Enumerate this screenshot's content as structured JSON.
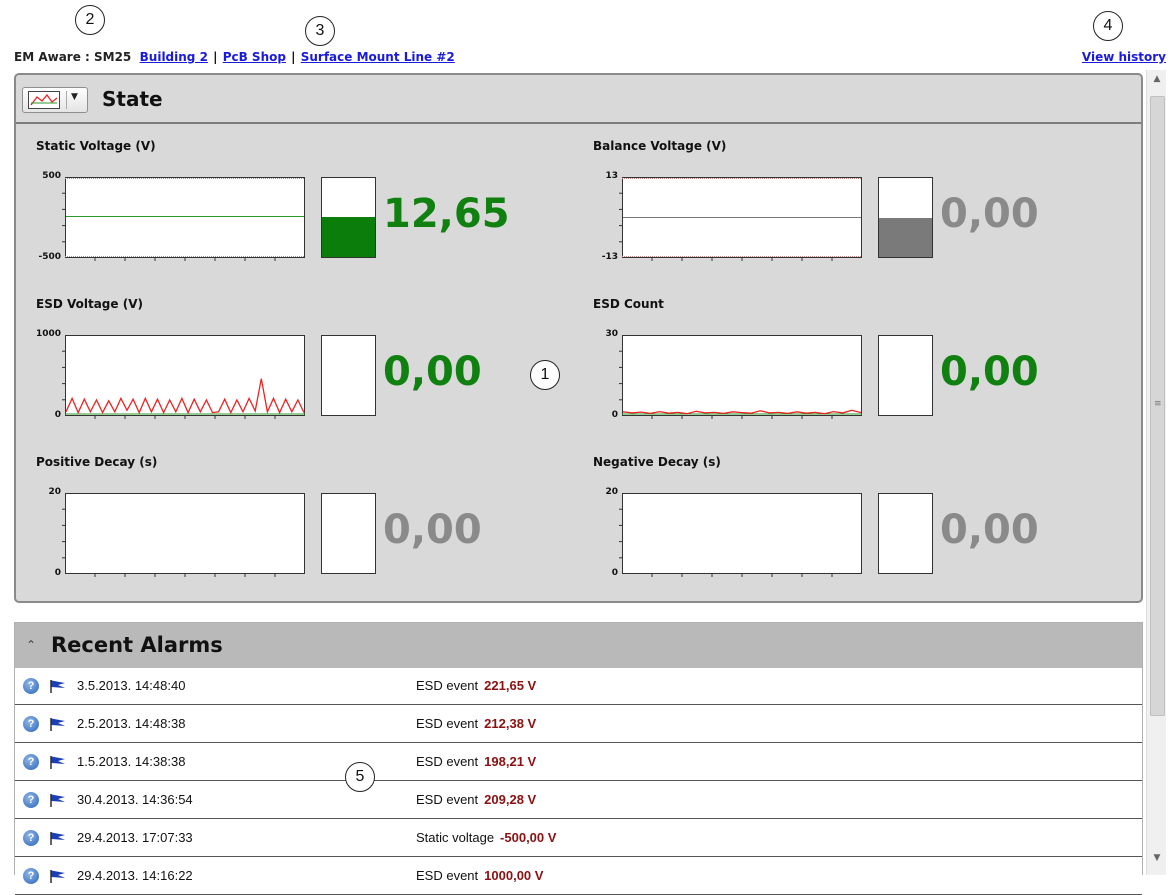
{
  "callouts": [
    "1",
    "2",
    "3",
    "4",
    "5"
  ],
  "breadcrumb": {
    "prefix": "EM Aware : SM25",
    "links": [
      "Building 2",
      "PcB Shop",
      "Surface Mount Line #2"
    ],
    "separator": "|"
  },
  "view_history": "View history",
  "state": {
    "title": "State",
    "metrics": [
      {
        "label": "Static Voltage (V)",
        "ymax": "500",
        "ymin": "-500",
        "value": "12,65",
        "value_color": "#108010",
        "gauge_level": 0.51,
        "gauge_color": "#0b7d0b"
      },
      {
        "label": "Balance Voltage (V)",
        "ymax": "13",
        "ymin": "-13",
        "value": "0,00",
        "value_color": "#8a8a8a",
        "gauge_level": 0.5,
        "gauge_color": "#7a7a7a"
      },
      {
        "label": "ESD Voltage (V)",
        "ymax": "1000",
        "ymin": "0",
        "value": "0,00",
        "value_color": "#108010",
        "gauge_level": 0,
        "gauge_color": "#0b7d0b"
      },
      {
        "label": "ESD Count",
        "ymax": "30",
        "ymin": "0",
        "value": "0,00",
        "value_color": "#108010",
        "gauge_level": 0,
        "gauge_color": "#0b7d0b"
      },
      {
        "label": "Positive Decay (s)",
        "ymax": "20",
        "ymin": "0",
        "value": "0,00",
        "value_color": "#8a8a8a",
        "gauge_level": 0,
        "gauge_color": "#7a7a7a"
      },
      {
        "label": "Negative Decay (s)",
        "ymax": "20",
        "ymin": "0",
        "value": "0,00",
        "value_color": "#8a8a8a",
        "gauge_level": 0,
        "gauge_color": "#7a7a7a"
      }
    ]
  },
  "chart_data": [
    {
      "type": "line",
      "title": "Static Voltage (V)",
      "ylim": [
        -500,
        500
      ],
      "series": [
        {
          "values": [
            12.65,
            12.65,
            12.65,
            12.65,
            12.65,
            12.65,
            12.65,
            12.65,
            12.65,
            12.65
          ]
        }
      ],
      "line_color": "#2a9a2a"
    },
    {
      "type": "line",
      "title": "Balance Voltage (V)",
      "ylim": [
        -13,
        13
      ],
      "series": [
        {
          "values": [
            0,
            0,
            0,
            0,
            0,
            0,
            0,
            0,
            0,
            0
          ]
        }
      ],
      "line_color": "#777777"
    },
    {
      "type": "line",
      "title": "ESD Voltage (V)",
      "ylim": [
        0,
        1000
      ],
      "series": [
        {
          "values": [
            40,
            210,
            30,
            200,
            40,
            190,
            30,
            180,
            40,
            210,
            60,
            200,
            30,
            210,
            40,
            200,
            30,
            190,
            40,
            210,
            30,
            200,
            40,
            190,
            30,
            40,
            200,
            30,
            190,
            40,
            210,
            50,
            460,
            40,
            210,
            30,
            200,
            40,
            190,
            30
          ]
        }
      ],
      "line_color": "#ee2222"
    },
    {
      "type": "line",
      "title": "ESD Count",
      "ylim": [
        0,
        30
      ],
      "series": [
        {
          "values": [
            1.2,
            0.8,
            1.1,
            0.6,
            1.3,
            0.7,
            1.0,
            0.5,
            1.4,
            0.8,
            1.0,
            0.6,
            1.2,
            0.9,
            0.7,
            1.6,
            0.8,
            1.0,
            0.6,
            1.2,
            0.7,
            1.0,
            0.5,
            1.3,
            0.8,
            1.8,
            0.9
          ]
        }
      ],
      "line_color": "#ee2222"
    },
    {
      "type": "line",
      "title": "Positive Decay (s)",
      "ylim": [
        0,
        20
      ],
      "series": [
        {
          "values": []
        }
      ],
      "line_color": "#2a9a2a"
    },
    {
      "type": "line",
      "title": "Negative Decay (s)",
      "ylim": [
        0,
        20
      ],
      "series": [
        {
          "values": []
        }
      ],
      "line_color": "#2a9a2a"
    }
  ],
  "alarms": {
    "title": "Recent Alarms",
    "rows": [
      {
        "time": "3.5.2013. 14:48:40",
        "type": "ESD event",
        "value": "221,65 V"
      },
      {
        "time": "2.5.2013. 14:48:38",
        "type": "ESD event",
        "value": "212,38 V"
      },
      {
        "time": "1.5.2013. 14:38:38",
        "type": "ESD event",
        "value": "198,21 V"
      },
      {
        "time": "30.4.2013. 14:36:54",
        "type": "ESD event",
        "value": "209,28 V"
      },
      {
        "time": "29.4.2013. 17:07:33",
        "type": "Static voltage",
        "value": "-500,00 V"
      },
      {
        "time": "29.4.2013. 14:16:22",
        "type": "ESD event",
        "value": "1000,00 V"
      }
    ]
  },
  "icons": {
    "help": "question-circle-icon",
    "flag": "flag-icon",
    "chart": "line-chart-icon",
    "collapse": "chevron-up-icon"
  }
}
